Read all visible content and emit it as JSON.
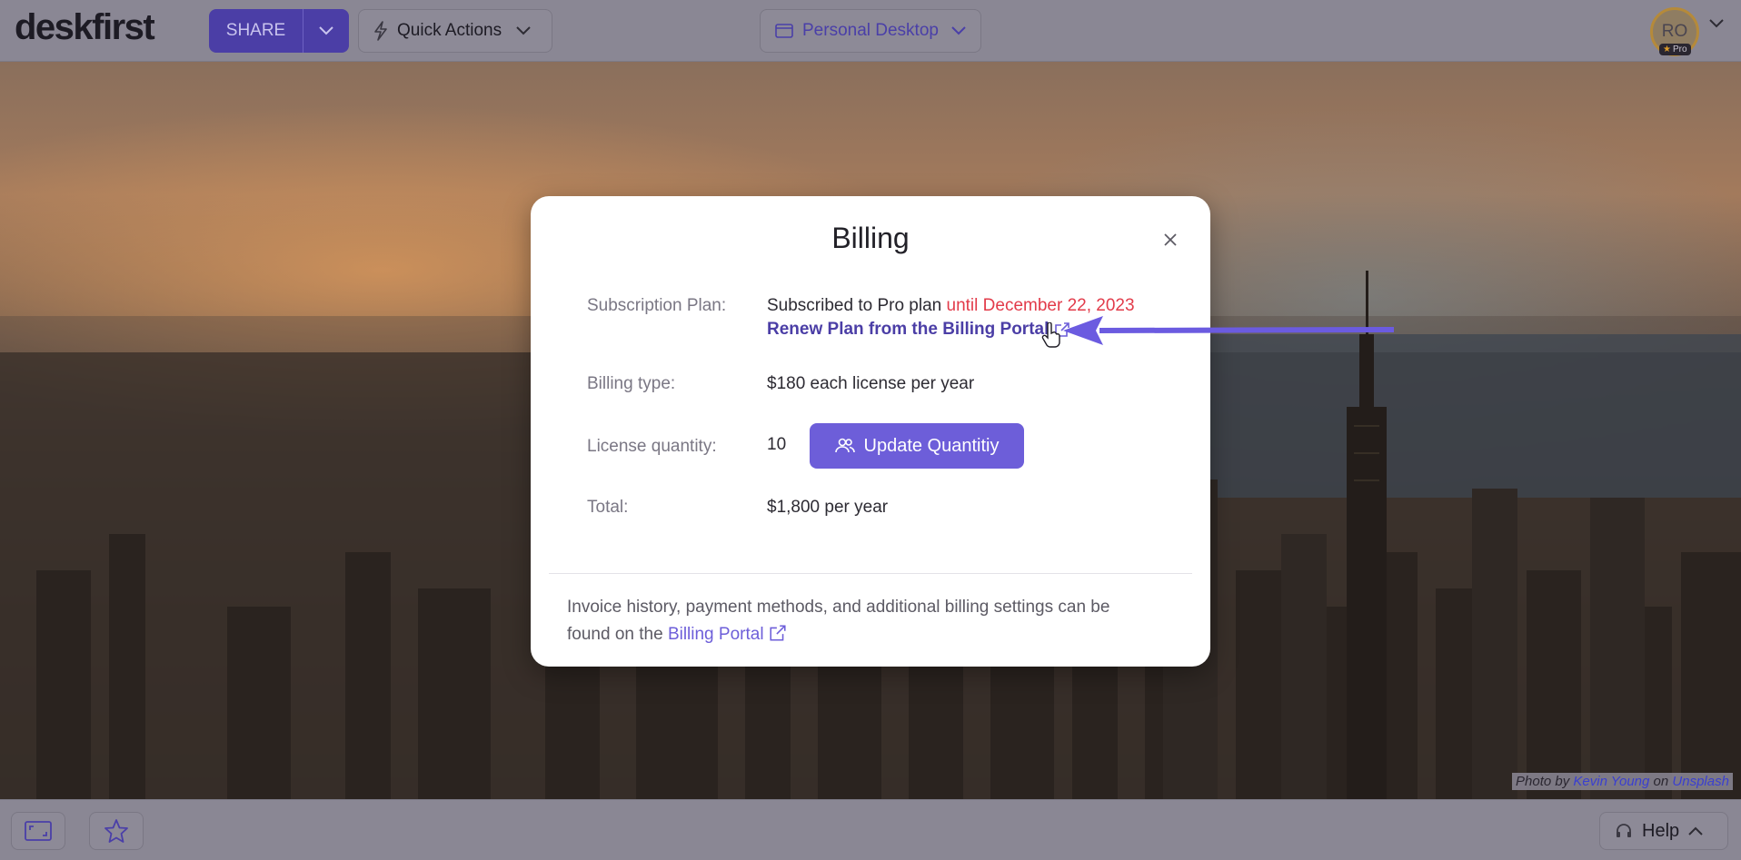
{
  "topbar": {
    "logo": "deskfirst",
    "share_label": "SHARE",
    "quick_actions_label": "Quick Actions",
    "desktop_label": "Personal Desktop",
    "avatar_initials": "RO",
    "pro_badge": "Pro"
  },
  "bottombar": {
    "help_label": "Help"
  },
  "credit": {
    "prefix": "Photo by",
    "author": "Kevin Young",
    "middle": "on",
    "source": "Unsplash"
  },
  "modal": {
    "title": "Billing",
    "subscription_label": "Subscription Plan:",
    "subscription_value": "Subscribed to Pro plan",
    "subscription_until": "until December 22, 2023",
    "renew_link": "Renew Plan from the Billing Portal",
    "billing_type_label": "Billing type:",
    "billing_type_value": "$180 each license per year",
    "license_quantity_label": "License quantity:",
    "license_quantity_value": "10",
    "update_button": "Update Quantitiy",
    "total_label": "Total:",
    "total_value": "$1,800 per year",
    "footer_text": "Invoice history, payment methods, and additional billing settings can be found on the",
    "footer_link": "Billing Portal"
  },
  "colors": {
    "accent": "#6d5ed9",
    "accent_dark": "#4b3ea6",
    "warning": "#e23b4a",
    "annotation": "#6b5be0"
  }
}
